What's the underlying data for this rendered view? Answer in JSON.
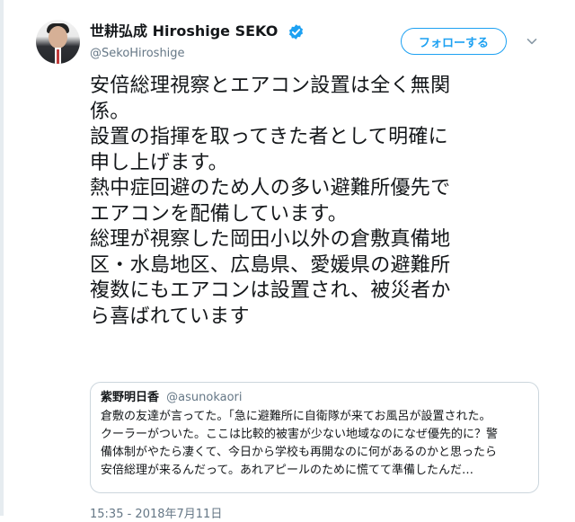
{
  "author": {
    "display_name": "世耕弘成 Hiroshige SEKO",
    "username": "@SekoHiroshige"
  },
  "follow_button_label": "フォローする",
  "tweet_lines": [
    "安倍総理視察とエアコン設置は全く無関",
    "係。",
    "設置の指揮を取ってきた者として明確に",
    "申し上げます。",
    "熱中症回避のため人の多い避難所優先で",
    "エアコンを配備しています。",
    "総理が視察した岡田小以外の倉敷真備地",
    "区・水島地区、広島県、愛媛県の避難所",
    "複数にもエアコンは設置され、被災者か",
    "ら喜ばれています"
  ],
  "quoted_tweet": {
    "display_name": "紫野明日香",
    "username": "@asunokaori",
    "lines": [
      "倉敷の友達が言ってた。「急に避難所に自衛隊が来てお風呂が設置された。",
      "クーラーがついた。ここは比較的被害が少ない地域なのになぜ優先的に？警",
      "備体制がやたら凄くて、今日から学校も再開なのに何があるのかと思ったら",
      "安倍総理が来るんだって。あれアピールのために慌てて準備したんだ…"
    ]
  },
  "timestamp": "15:35 - 2018年7月11日",
  "colors": {
    "accent": "#1da1f2",
    "secondary_text": "#657786",
    "border": "#ccd6dd"
  },
  "icons": {
    "verified": "verified-badge-icon",
    "menu": "chevron-down-icon"
  }
}
